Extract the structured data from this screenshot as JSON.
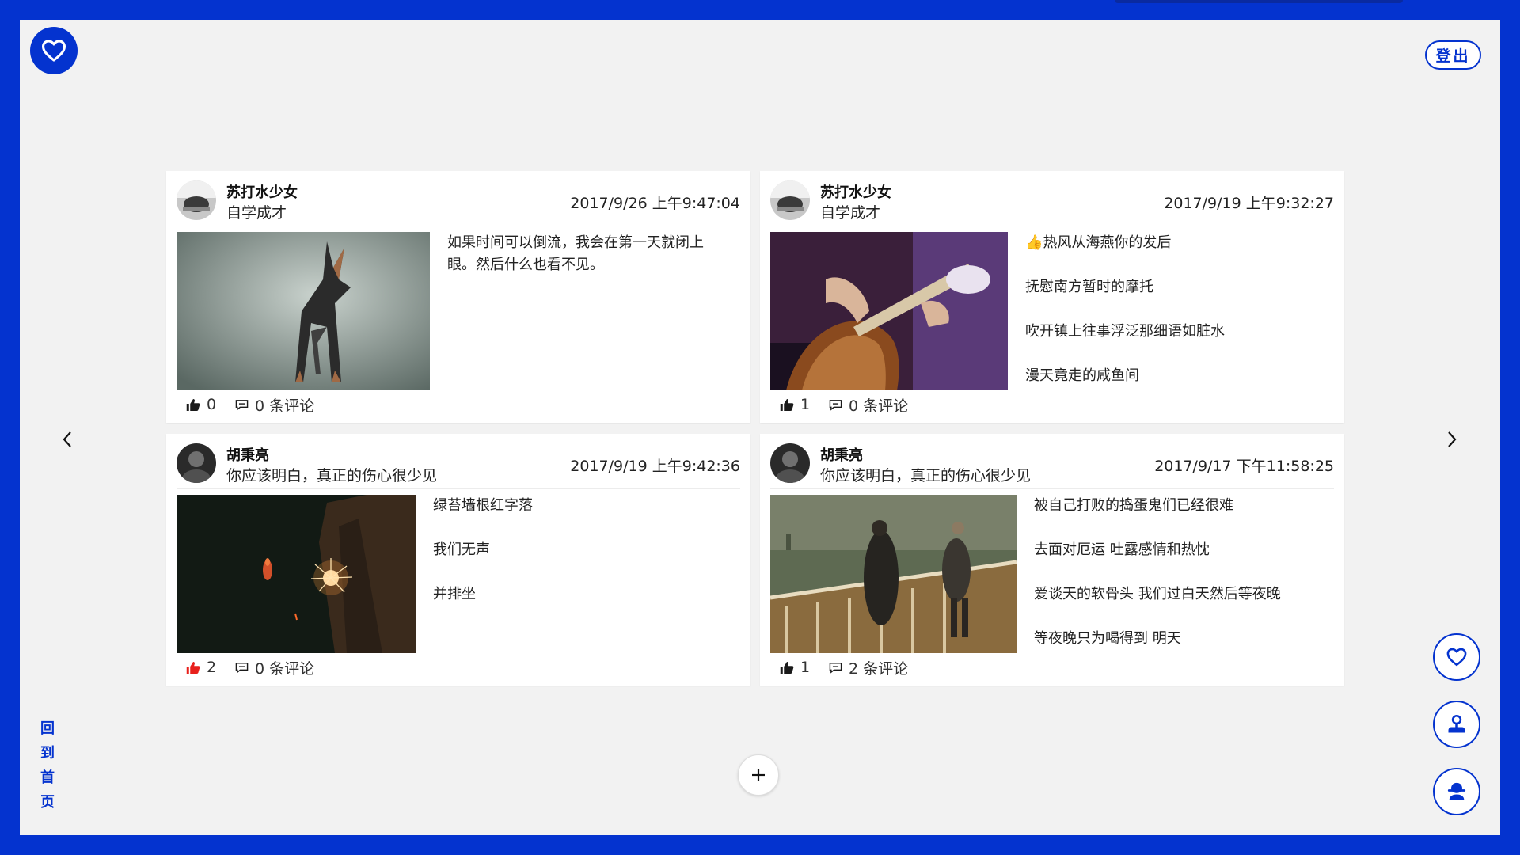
{
  "header": {
    "logout_label": "登出",
    "back_home_label": "回到首页"
  },
  "colors": {
    "brand": "#0433cf",
    "liked": "#e8201c",
    "card_bg": "#ffffff",
    "page_bg": "#f2f2f2"
  },
  "posts": [
    {
      "username": "苏打水少女",
      "subtitle": "自学成才",
      "timestamp": "2017/9/26 上午9:47:04",
      "paragraphs": [
        "如果时间可以倒流，我会在第一天就闭上眼。然后什么也看不见。"
      ],
      "likes": "0",
      "comments": "0 条评论",
      "liked": false,
      "image": "origami-dog-photo"
    },
    {
      "username": "苏打水少女",
      "subtitle": "自学成才",
      "timestamp": "2017/9/19 上午9:32:27",
      "paragraphs": [
        "👍热风从海燕你的发后",
        "抚慰南方暂时的摩托",
        "吹开镇上往事浮泛那细语如脏水",
        "漫天竟走的咸鱼间"
      ],
      "likes": "1",
      "comments": "0 条评论",
      "liked": false,
      "image": "guitar-photo"
    },
    {
      "username": "胡秉亮",
      "subtitle": "你应该明白，真正的伤心很少见",
      "timestamp": "2017/9/19 上午9:42:36",
      "paragraphs": [
        "绿苔墙根红字落",
        "我们无声",
        "并排坐"
      ],
      "likes": "2",
      "comments": "0 条评论",
      "liked": true,
      "image": "sparkler-photo"
    },
    {
      "username": "胡秉亮",
      "subtitle": "你应该明白，真正的伤心很少见",
      "timestamp": "2017/9/17 下午11:58:25",
      "paragraphs": [
        "被自己打败的捣蛋鬼们已经很难",
        "去面对厄运 吐露感情和热忱",
        "爱谈天的软骨头 我们过白天然后等夜晚",
        "等夜晚只为喝得到 明天"
      ],
      "likes": "1",
      "comments": "2 条评论",
      "liked": false,
      "image": "ship-deck-photo"
    }
  ],
  "side_buttons": [
    "heart-icon",
    "user-icon",
    "user-filled-icon"
  ]
}
